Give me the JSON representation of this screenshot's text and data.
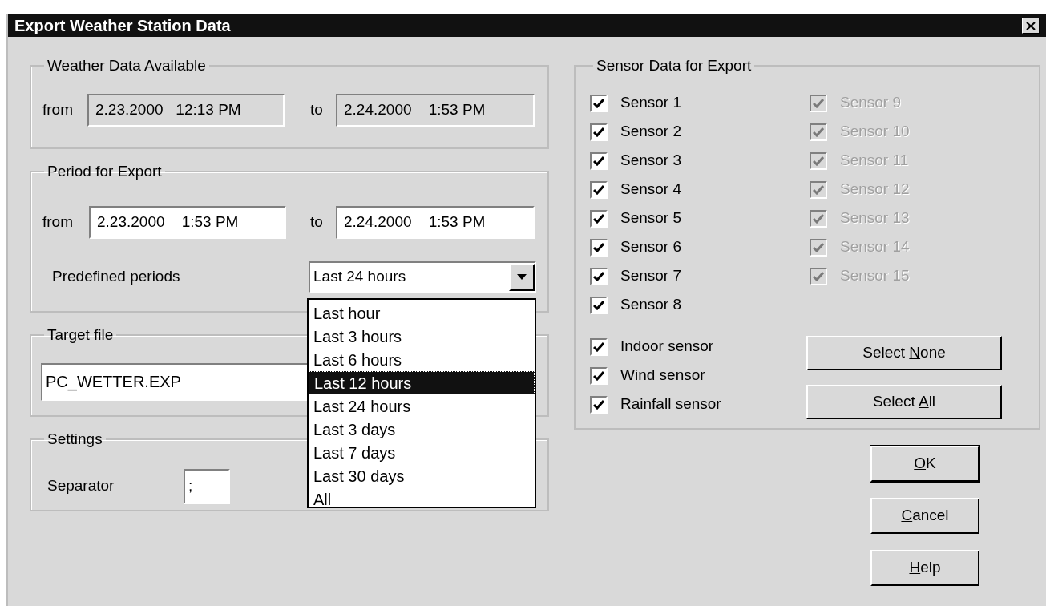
{
  "window": {
    "title": "Export Weather Station Data"
  },
  "available": {
    "label": "Weather Data Available",
    "from_label": "from",
    "from": {
      "value": "2.23.2000   12:13 PM",
      "readonly": true
    },
    "to_label": "to",
    "to": {
      "value": "2.24.2000    1:53 PM",
      "readonly": true
    }
  },
  "period": {
    "label": "Period for Export",
    "from_label": "from",
    "from": {
      "value": "2.23.2000    1:53 PM",
      "readonly": false
    },
    "to_label": "to",
    "to": {
      "value": "2.24.2000    1:53 PM",
      "readonly": false
    },
    "predefined_label": "Predefined periods",
    "predefined_value": "Last 24 hours",
    "expanded": true,
    "options": [
      {
        "label": "Last hour",
        "selected": false
      },
      {
        "label": "Last 3 hours",
        "selected": false
      },
      {
        "label": "Last 6 hours",
        "selected": false
      },
      {
        "label": "Last 12 hours",
        "selected": true
      },
      {
        "label": "Last 24 hours",
        "selected": false
      },
      {
        "label": "Last 3 days",
        "selected": false
      },
      {
        "label": "Last 7 days",
        "selected": false
      },
      {
        "label": "Last 30 days",
        "selected": false
      },
      {
        "label": "All",
        "selected": false
      }
    ]
  },
  "target": {
    "label": "Target file",
    "value": "PC_WETTER.EXP"
  },
  "settings": {
    "label": "Settings",
    "separator_label": "Separator",
    "separator": ";"
  },
  "sensors": {
    "label": "Sensor Data for Export",
    "columns": [
      [
        {
          "label": "Sensor 1",
          "checked": true,
          "disabled": false
        },
        {
          "label": "Sensor 2",
          "checked": true,
          "disabled": false
        },
        {
          "label": "Sensor 3",
          "checked": true,
          "disabled": false
        },
        {
          "label": "Sensor 4",
          "checked": true,
          "disabled": false
        },
        {
          "label": "Sensor 5",
          "checked": true,
          "disabled": false
        },
        {
          "label": "Sensor 6",
          "checked": true,
          "disabled": false
        },
        {
          "label": "Sensor 7",
          "checked": true,
          "disabled": false
        },
        {
          "label": "Sensor 8",
          "checked": true,
          "disabled": false
        }
      ],
      [
        {
          "label": "Sensor 9",
          "checked": true,
          "disabled": true
        },
        {
          "label": "Sensor 10",
          "checked": true,
          "disabled": true
        },
        {
          "label": "Sensor 11",
          "checked": true,
          "disabled": true
        },
        {
          "label": "Sensor 12",
          "checked": true,
          "disabled": true
        },
        {
          "label": "Sensor 13",
          "checked": true,
          "disabled": true
        },
        {
          "label": "Sensor 14",
          "checked": true,
          "disabled": true
        },
        {
          "label": "Sensor 15",
          "checked": true,
          "disabled": true
        }
      ]
    ],
    "other": [
      {
        "label": "Indoor sensor",
        "checked": true,
        "disabled": false
      },
      {
        "label": "Wind sensor",
        "checked": true,
        "disabled": false
      },
      {
        "label": "Rainfall sensor",
        "checked": true,
        "disabled": false
      }
    ],
    "select_none": {
      "before": "Select ",
      "key": "N",
      "after": "one"
    },
    "select_all": {
      "before": "Select ",
      "key": "A",
      "after": "ll"
    }
  },
  "buttons": [
    {
      "key": "O",
      "after": "K",
      "default": true
    },
    {
      "key": "C",
      "after": "ancel",
      "default": false
    },
    {
      "key": "H",
      "after": "elp",
      "default": false
    }
  ]
}
